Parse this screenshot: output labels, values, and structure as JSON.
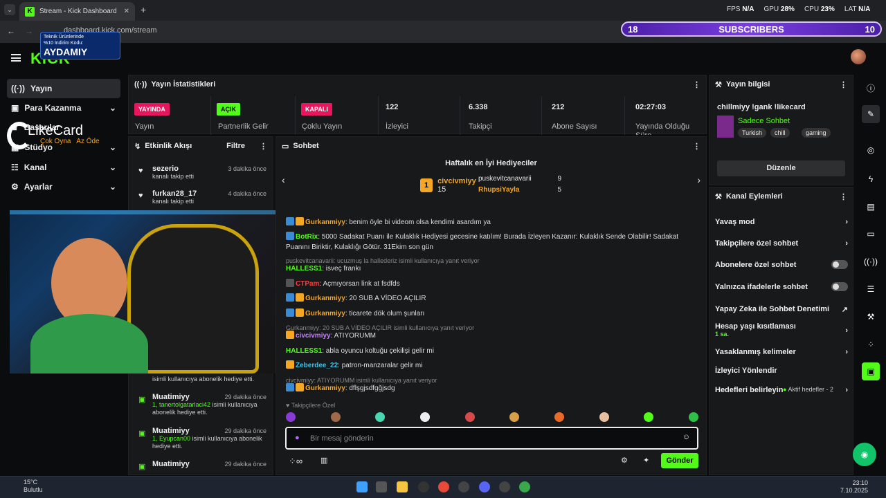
{
  "browser": {
    "tab_title": "Stream - Kick Dashboard",
    "url": "dashboard.kick.com/stream"
  },
  "overlay_stats": {
    "fps_label": "FPS",
    "fps": "N/A",
    "gpu_label": "GPU",
    "gpu": "28",
    "cpu_label": "CPU",
    "cpu": "23",
    "lat_label": "LAT",
    "lat": "N/A",
    "pct": "%"
  },
  "subscribers": {
    "left": "18",
    "label": "SUBSCRIBERS",
    "right": "10"
  },
  "promo": {
    "line1": "Teknik Ürünlerinde",
    "line2": "%10 İndirim Kodu:",
    "code": "AYDAMIY"
  },
  "likecard": {
    "name": "LikeCard",
    "tag1": "Çok Oyna",
    "tag2": "Az Öde"
  },
  "logo": "KICK",
  "sidebar": {
    "items": [
      {
        "label": "Yayın"
      },
      {
        "label": "Para Kazanma"
      },
      {
        "label": "Başarılar"
      },
      {
        "label": "Stüdyo"
      },
      {
        "label": "Kanal"
      },
      {
        "label": "Ayarlar"
      }
    ]
  },
  "stats_panel": {
    "title": "Yayın İstatistikleri",
    "cells": [
      {
        "badge": "YAYINDA",
        "label": "Yayın",
        "color": "#e8175d"
      },
      {
        "badge": "AÇIK",
        "label": "Partnerlik Gelir",
        "color": "#53fc18"
      },
      {
        "badge": "KAPALI",
        "label": "Çoklu Yayın",
        "color": "#e8175d"
      },
      {
        "value": "122",
        "label": "İzleyici"
      },
      {
        "value": "6.338",
        "label": "Takipçi"
      },
      {
        "value": "212",
        "label": "Abone Sayısı"
      },
      {
        "value": "02:27:03",
        "label": "Yayında Olduğu Süre"
      }
    ]
  },
  "activity": {
    "title": "Etkinlik Akışı",
    "filter": "Filtre",
    "items": [
      {
        "name": "sezerio",
        "time": "3 dakika önce",
        "desc": "kanalı takip etti"
      },
      {
        "name": "furkan28_17",
        "time": "4 dakika önce",
        "desc": "kanalı takip etti"
      },
      {
        "name": "",
        "time": "",
        "desc": "isimli kullanıcıya abonelik hediye etti."
      },
      {
        "name": "Muatimiyy",
        "time": "29 dakika önce",
        "gift": "1, tanertolgatarlaci42",
        "desc": "isimli kullanıcıya abonelik hediye etti."
      },
      {
        "name": "Muatimiyy",
        "time": "29 dakika önce",
        "gift": "1, Eyupcan00",
        "desc": "isimli kullanıcıya abonelik hediye etti."
      },
      {
        "name": "Muatimiyy",
        "time": "29 dakika önce"
      }
    ]
  },
  "chat": {
    "title": "Sohbet",
    "gifters_title": "Haftalık en İyi Hediyeciler",
    "gifters": [
      {
        "rank": "1",
        "name": "civcivmiyy",
        "count": "15"
      },
      {
        "name": "puskevitcanavarii",
        "count": "9"
      },
      {
        "name": "RhupsiYayla",
        "count": "5"
      }
    ],
    "messages": [
      {
        "user": "Gurkanmiyy",
        "ucolor": "#f5a623",
        "text": "benim öyle bi videom olsa kendimi asardım ya"
      },
      {
        "user": "BotRix",
        "ucolor": "#53fc18",
        "text": "5000 Sadakat Puanı ile Kulaklık Hediyesi gecesine katılım! Burada İzleyen Kazanır: Kulaklık Sende Olabilir! Sadakat Puanını Biriktir, Kulaklığı Götür. 31Ekim son gün"
      },
      {
        "reply": "puskevitcanavarii: ucuzmuş la hallederiz isimli kullanıcıya yanıt veriyor",
        "user": "HALLESS1",
        "ucolor": "#53fc18",
        "text": "isveç frankı"
      },
      {
        "user": "CTPam",
        "ucolor": "#ff3b3b",
        "text": "Açmıyorsan link at fsdfds"
      },
      {
        "user": "Gurkanmiyy",
        "ucolor": "#f5a623",
        "text": "20 SUB A VİDEO AÇILIR"
      },
      {
        "user": "Gurkanmiyy",
        "ucolor": "#f5a623",
        "text": "ticarete dök olum şunları"
      },
      {
        "reply": "Gurkanmiyy: 20 SUB A VİDEO AÇILIR isimli kullanıcıya yanıt veriyor",
        "user": "civcivmiyy",
        "ucolor": "#c77dff",
        "text": "ATIYORUMM"
      },
      {
        "user": "HALLESS1",
        "ucolor": "#53fc18",
        "text": "abla oyuncu koltuğu çekilişi gelir mi"
      },
      {
        "user": "Zeberdee_22",
        "ucolor": "#3ec3e8",
        "text": "patron-manzaralar gelir mi"
      },
      {
        "reply": "civcivmiyy: ATIYORUMM isimli kullanıcıya yanıt veriyor",
        "user": "Gurkanmiyy",
        "ucolor": "#f5a623",
        "text": "dflşgjsdfgğjsdg"
      }
    ],
    "followers_only": "Takipçilere Özel",
    "input_placeholder": "Bir mesaj gönderin",
    "send": "Gönder"
  },
  "stream_info": {
    "title": "Yayın bilgisi",
    "stream_title": "chillmiyy !gank !likecard",
    "category": "Sadece Sohbet",
    "tags": [
      "Turkish",
      "chill",
      "gaming"
    ],
    "edit": "Düzenle"
  },
  "channel_actions": {
    "title": "Kanal Eylemleri",
    "items": [
      {
        "label": "Yavaş mod"
      },
      {
        "label": "Takipçilere özel sohbet"
      },
      {
        "label": "Abonelere özel sohbet"
      },
      {
        "label": "Yalnızca ifadelerle sohbet"
      },
      {
        "label": "Yapay Zeka ile Sohbet Denetimi"
      },
      {
        "label": "Hesap yaşı kısıtlaması",
        "sub": "1 sa."
      },
      {
        "label": "Yasaklanmış kelimeler"
      },
      {
        "label": "İzleyici Yönlendir"
      },
      {
        "label": "Hedefleri belirleyin",
        "sub": "Aktif hedefler - 2"
      }
    ]
  },
  "taskbar": {
    "temp": "15°C",
    "weather": "Bulutlu",
    "time": "23:10",
    "date": "7.10.2025"
  }
}
